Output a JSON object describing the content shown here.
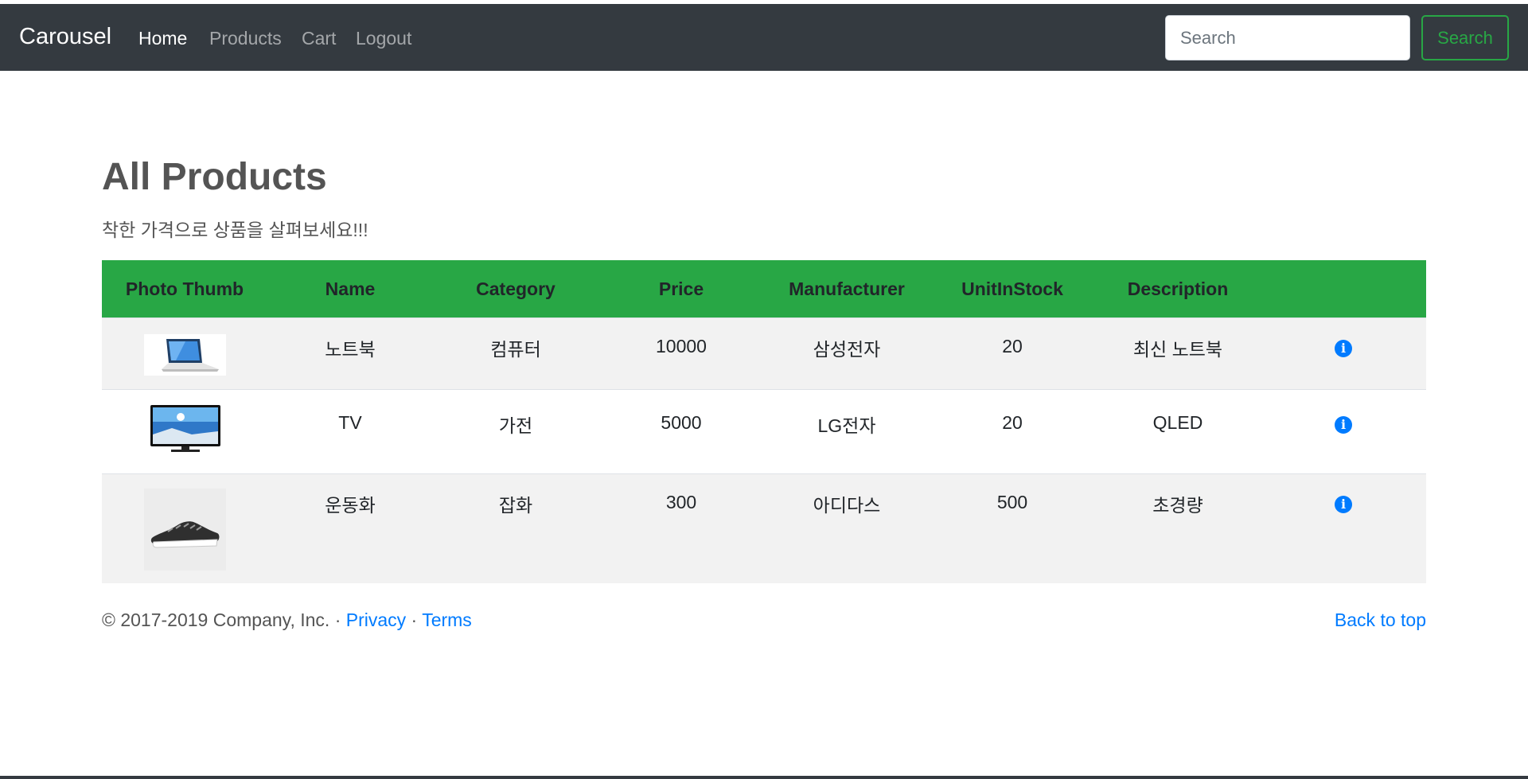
{
  "navbar": {
    "brand": "Carousel",
    "links": [
      {
        "label": "Home",
        "active": true
      },
      {
        "label": "Products",
        "active": false
      },
      {
        "label": "Cart",
        "active": false
      },
      {
        "label": "Logout",
        "active": false
      }
    ],
    "search": {
      "placeholder": "Search",
      "value": "",
      "button_label": "Search"
    }
  },
  "main": {
    "title": "All Products",
    "subtitle": "착한 가격으로 상품을 살펴보세요!!!"
  },
  "table": {
    "headers": [
      "Photo Thumb",
      "Name",
      "Category",
      "Price",
      "Manufacturer",
      "UnitInStock",
      "Description",
      ""
    ],
    "rows": [
      {
        "thumb": "laptop-thumbnail",
        "name": "노트북",
        "category": "컴퓨터",
        "price": "10000",
        "manufacturer": "삼성전자",
        "stock": "20",
        "description": "최신 노트북",
        "action_icon": "info-icon"
      },
      {
        "thumb": "tv-thumbnail",
        "name": "TV",
        "category": "가전",
        "price": "5000",
        "manufacturer": "LG전자",
        "stock": "20",
        "description": "QLED",
        "action_icon": "info-icon"
      },
      {
        "thumb": "sneaker-thumbnail",
        "name": "운동화",
        "category": "잡화",
        "price": "300",
        "manufacturer": "아디다스",
        "stock": "500",
        "description": "초경량",
        "action_icon": "info-icon"
      }
    ]
  },
  "footer": {
    "copyright": "© 2017-2019 Company, Inc. · ",
    "privacy": "Privacy",
    "separator": " · ",
    "terms": "Terms",
    "back_to_top": "Back to top"
  },
  "colors": {
    "navbar": "#343a40",
    "table_header": "#28a745",
    "link": "#007bff",
    "stripe": "#f2f2f2"
  }
}
